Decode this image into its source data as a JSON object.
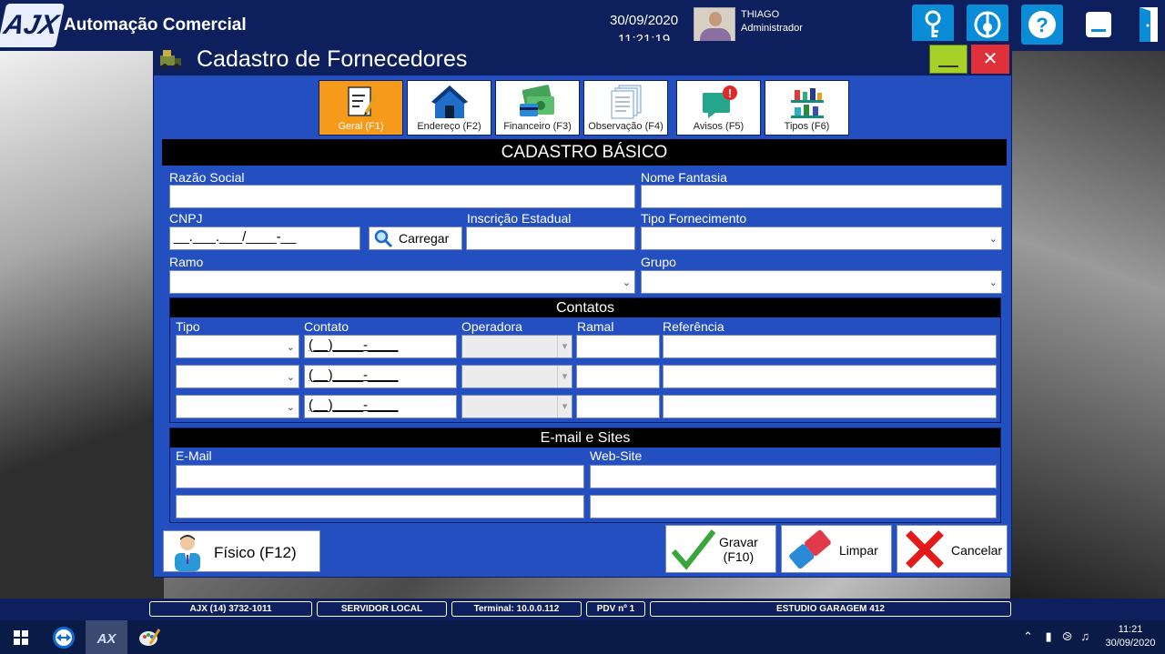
{
  "app": {
    "title": "Automação Comercial",
    "logo_text": "AJX"
  },
  "header": {
    "date": "30/09/2020",
    "time": "11:21:19",
    "user_name": "THIAGO",
    "user_role": "Administrador"
  },
  "window": {
    "title": "Cadastro de Fornecedores",
    "close_glyph": "✕"
  },
  "tabs": [
    {
      "label": "Geral (F1)",
      "icon": "document-edit-icon"
    },
    {
      "label": "Endereço (F2)",
      "icon": "house-icon"
    },
    {
      "label": "Financeiro (F3)",
      "icon": "money-card-icon"
    },
    {
      "label": "Observação (F4)",
      "icon": "documents-icon"
    },
    {
      "label": "Avisos (F5)",
      "icon": "alert-chat-icon"
    },
    {
      "label": "Tipos (F6)",
      "icon": "shelf-icon"
    }
  ],
  "section": {
    "title": "CADASTRO BÁSICO"
  },
  "form": {
    "razao_social": "Razão Social",
    "nome_fantasia": "Nome Fantasia",
    "cnpj": "CNPJ",
    "cnpj_value": "__.___.___/____-__",
    "carregar": "Carregar",
    "inscricao_estadual": "Inscrição Estadual",
    "tipo_fornecimento": "Tipo Fornecimento",
    "ramo": "Ramo",
    "grupo": "Grupo"
  },
  "contatos": {
    "title": "Contatos",
    "columns": {
      "tipo": "Tipo",
      "contato": "Contato",
      "operadora": "Operadora",
      "ramal": "Ramal",
      "referencia": "Referência"
    },
    "rows": [
      {
        "contato": "(__)____-____"
      },
      {
        "contato": "(__)____-____"
      },
      {
        "contato": "(__)____-____"
      }
    ]
  },
  "email_sites": {
    "title": "E-mail e Sites",
    "email": "E-Mail",
    "website": "Web-Site"
  },
  "buttons": {
    "fisico": "Físico (F12)",
    "gravar": "Gravar\n(F10)",
    "gravar_1": "Gravar",
    "gravar_2": "(F10)",
    "limpar": "Limpar",
    "cancelar": "Cancelar"
  },
  "statusbar": [
    "AJX (14) 3732-1011",
    "SERVIDOR LOCAL",
    "Terminal: 10.0.0.112",
    "PDV nº 1",
    "ESTUDIO GARAGEM 412"
  ],
  "taskbar": {
    "clock_time": "11:21",
    "clock_date": "30/09/2020"
  },
  "colors": {
    "window_bg": "#234fc0",
    "titlebar": "#0d1f5c",
    "active_tab": "#f59a1a",
    "accent_blue": "#0a8cd6"
  }
}
